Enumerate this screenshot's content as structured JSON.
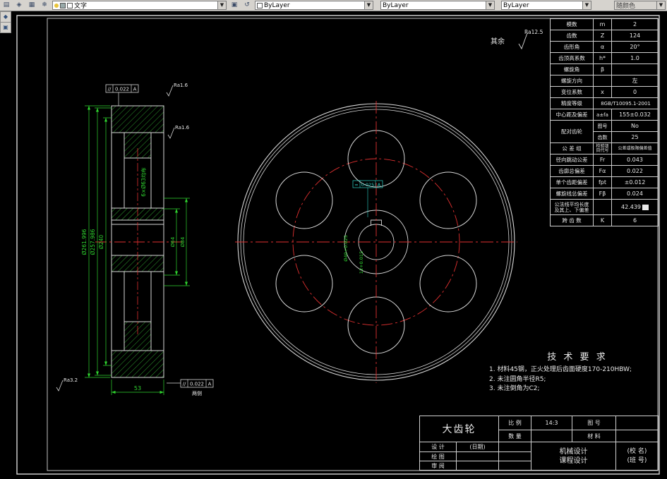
{
  "toolbar": {
    "text_style_combo": "文字",
    "color_combo": "ByLayer",
    "linetype_combo": "ByLayer",
    "lineweight_combo": "ByLayer",
    "plot_style_combo": "随颜色"
  },
  "drawing": {
    "rest_label": "其余",
    "rest_ra": "Ra12.5",
    "side": {
      "dim_od1": "Ø261.996",
      "dim_od2": "Ø257.986",
      "dim_od3": "Ø240",
      "dim_hub_inner": "Ø64",
      "dim_hub_outer": "Ø84",
      "dim_width": "53",
      "holes_note": "6×Ø63均布",
      "tol_sym": "//",
      "tol_val": "0.022",
      "tol_datum": "A",
      "both_sides": "两侧",
      "ra_top": "Ra1.6",
      "ra_mid": "Ra1.6",
      "ra_bottom": "Ra3.2"
    },
    "front": {
      "bore_dim": "Ø40+0.025",
      "key_dim": "12+0.015",
      "sym_frame_sym": "=",
      "sym_frame_val": "0.025",
      "sym_frame_datum": "A"
    }
  },
  "param_table": {
    "rows": [
      {
        "label": "模数",
        "sym": "m",
        "val": "2"
      },
      {
        "label": "齿数",
        "sym": "Z",
        "val": "124"
      },
      {
        "label": "齿形角",
        "sym": "α",
        "val": "20°"
      },
      {
        "label": "齿顶高系数",
        "sym": "h*",
        "val": "1.0"
      },
      {
        "label": "螺旋角",
        "sym": "β",
        "val": ""
      },
      {
        "label": "螺旋方向",
        "sym": "",
        "val": "左"
      },
      {
        "label": "变位系数",
        "sym": "x",
        "val": "0"
      },
      {
        "label": "精度等级",
        "val": "8GB/T10095.1-2001"
      },
      {
        "label": "中心距及偏差",
        "sym": "a±fa",
        "val": "155±0.032"
      },
      {
        "label": "配对齿轮",
        "sym": "图号",
        "val": "No"
      },
      {
        "label": "",
        "sym": "齿数",
        "val": "25"
      },
      {
        "label": "公 差 组",
        "sym": "检验项目代号",
        "val": "公差或极限偏差值"
      },
      {
        "label": "径向跳动公差",
        "sym": "Fr",
        "val": "0.043"
      },
      {
        "label": "齿廓总偏差",
        "sym": "Fα",
        "val": "0.022"
      },
      {
        "label": "单个齿距偏差",
        "sym": "fpt",
        "val": "±0.012"
      },
      {
        "label": "螺旋线总偏差",
        "sym": "Fβ",
        "val": "0.024"
      },
      {
        "label": "公法线平均长度\n及其上、下偏差",
        "sym": "",
        "val": "42.439"
      },
      {
        "label": "跨 齿 数",
        "sym": "K",
        "val": "6"
      }
    ]
  },
  "tech_req": {
    "title": "技 术 要 求",
    "line1": "1. 材料45钢，正火处理后齿面硬度170-210HBW;",
    "line2": "2. 未注圆角半径R5;",
    "line3": "3. 未注倒角为C2;"
  },
  "title_block": {
    "part_name": "大齿轮",
    "scale_label": "比 例",
    "scale_value": "14:3",
    "no_label": "图 号",
    "qty_label": "数 量",
    "mat_label": "材 料",
    "design_label": "设 计",
    "date_note": "(日期)",
    "draw_label": "绘 图",
    "check_label": "审 阅",
    "course1": "机械设计",
    "course2": "课程设计",
    "school1": "(校 名)",
    "school2": "(班 号)"
  }
}
